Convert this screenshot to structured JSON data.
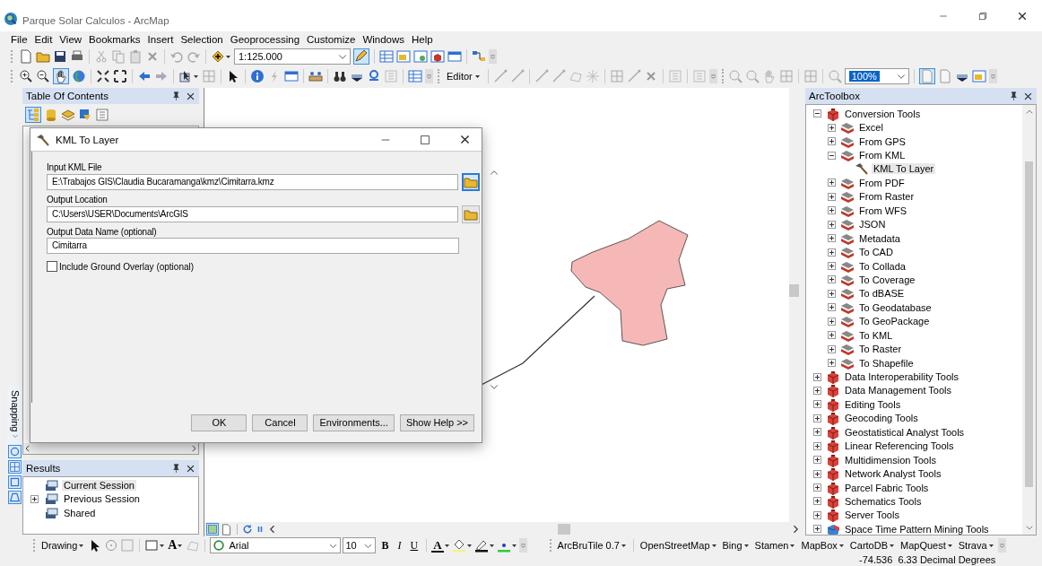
{
  "window": {
    "title": "Parque Solar Calculos - ArcMap"
  },
  "menu": [
    "File",
    "Edit",
    "View",
    "Bookmarks",
    "Insert",
    "Selection",
    "Geoprocessing",
    "Customize",
    "Windows",
    "Help"
  ],
  "standard_toolbar": {
    "scale": "1:125.000"
  },
  "tools_toolbar": {
    "editor_menu": "Editor",
    "zoom_field": "100%"
  },
  "table_of_contents": {
    "title": "Table Of Contents"
  },
  "snapping": {
    "title": "Snapping"
  },
  "results": {
    "title": "Results",
    "items": [
      {
        "label": "Current Session",
        "selected": true,
        "expandable": false
      },
      {
        "label": "Previous Session",
        "selected": false,
        "expandable": true
      },
      {
        "label": "Shared",
        "selected": false,
        "expandable": false
      }
    ]
  },
  "dialog": {
    "title": "KML To Layer",
    "fields": [
      {
        "label": "Input KML File",
        "value": "E:\\Trabajos GIS\\Claudia Bucaramanga\\kmz\\Cimitarra.kmz",
        "kind": "browse",
        "focused": true
      },
      {
        "label": "Output Location",
        "value": "C:\\Users\\USER\\Documents\\ArcGIS",
        "kind": "browse",
        "focused": false
      },
      {
        "label": "Output Data Name (optional)",
        "value": "Cimitarra",
        "kind": "text"
      }
    ],
    "checkbox": {
      "label": "Include Ground Overlay (optional)",
      "checked": false
    },
    "buttons": [
      "OK",
      "Cancel",
      "Environments...",
      "Show Help >>"
    ]
  },
  "toolbox": {
    "title": "ArcToolbox",
    "items": [
      {
        "label": "Conversion Tools",
        "kind": "toolbox",
        "expanded": true,
        "selected": false,
        "children": [
          {
            "label": "Excel",
            "kind": "toolset",
            "expanded": false,
            "selected": false
          },
          {
            "label": "From GPS",
            "kind": "toolset",
            "expanded": false,
            "selected": false
          },
          {
            "label": "From KML",
            "kind": "toolset",
            "expanded": true,
            "selected": false,
            "children": [
              {
                "label": "KML To Layer",
                "kind": "tool",
                "selected": true
              }
            ]
          },
          {
            "label": "From PDF",
            "kind": "toolset",
            "expanded": false,
            "selected": false
          },
          {
            "label": "From Raster",
            "kind": "toolset",
            "expanded": false,
            "selected": false
          },
          {
            "label": "From WFS",
            "kind": "toolset",
            "expanded": false,
            "selected": false
          },
          {
            "label": "JSON",
            "kind": "toolset",
            "expanded": false,
            "selected": false
          },
          {
            "label": "Metadata",
            "kind": "toolset",
            "expanded": false,
            "selected": false
          },
          {
            "label": "To CAD",
            "kind": "toolset",
            "expanded": false,
            "selected": false
          },
          {
            "label": "To Collada",
            "kind": "toolset",
            "expanded": false,
            "selected": false
          },
          {
            "label": "To Coverage",
            "kind": "toolset",
            "expanded": false,
            "selected": false
          },
          {
            "label": "To dBASE",
            "kind": "toolset",
            "expanded": false,
            "selected": false
          },
          {
            "label": "To Geodatabase",
            "kind": "toolset",
            "expanded": false,
            "selected": false
          },
          {
            "label": "To GeoPackage",
            "kind": "toolset",
            "expanded": false,
            "selected": false
          },
          {
            "label": "To KML",
            "kind": "toolset",
            "expanded": false,
            "selected": false
          },
          {
            "label": "To Raster",
            "kind": "toolset",
            "expanded": false,
            "selected": false
          },
          {
            "label": "To Shapefile",
            "kind": "toolset",
            "expanded": false,
            "selected": false
          }
        ]
      },
      {
        "label": "Data Interoperability Tools",
        "kind": "toolbox",
        "expanded": false,
        "selected": false
      },
      {
        "label": "Data Management Tools",
        "kind": "toolbox",
        "expanded": false,
        "selected": false
      },
      {
        "label": "Editing Tools",
        "kind": "toolbox",
        "expanded": false,
        "selected": false
      },
      {
        "label": "Geocoding Tools",
        "kind": "toolbox",
        "expanded": false,
        "selected": false
      },
      {
        "label": "Geostatistical Analyst Tools",
        "kind": "toolbox",
        "expanded": false,
        "selected": false
      },
      {
        "label": "Linear Referencing Tools",
        "kind": "toolbox",
        "expanded": false,
        "selected": false
      },
      {
        "label": "Multidimension Tools",
        "kind": "toolbox",
        "expanded": false,
        "selected": false
      },
      {
        "label": "Network Analyst Tools",
        "kind": "toolbox",
        "expanded": false,
        "selected": false
      },
      {
        "label": "Parcel Fabric Tools",
        "kind": "toolbox",
        "expanded": false,
        "selected": false
      },
      {
        "label": "Schematics Tools",
        "kind": "toolbox",
        "expanded": false,
        "selected": false
      },
      {
        "label": "Server Tools",
        "kind": "toolbox",
        "expanded": false,
        "selected": false
      },
      {
        "label": "Space Time Pattern Mining Tools",
        "kind": "script-toolbox",
        "expanded": false,
        "selected": false
      }
    ]
  },
  "drawing_toolbar": {
    "menu": "Drawing",
    "text_tool": "A",
    "font": "Arial",
    "size": "10",
    "bold": "B",
    "italic": "I",
    "underline": "U",
    "font_color": "A"
  },
  "tile_toolbar": [
    "ArcBruTile 0.7",
    "OpenStreetMap",
    "Bing",
    "Stamen",
    "MapBox",
    "CartoDB",
    "MapQuest",
    "Strava"
  ],
  "status_bar": {
    "coordinates": "-74.536  6.33 Decimal Degrees"
  }
}
